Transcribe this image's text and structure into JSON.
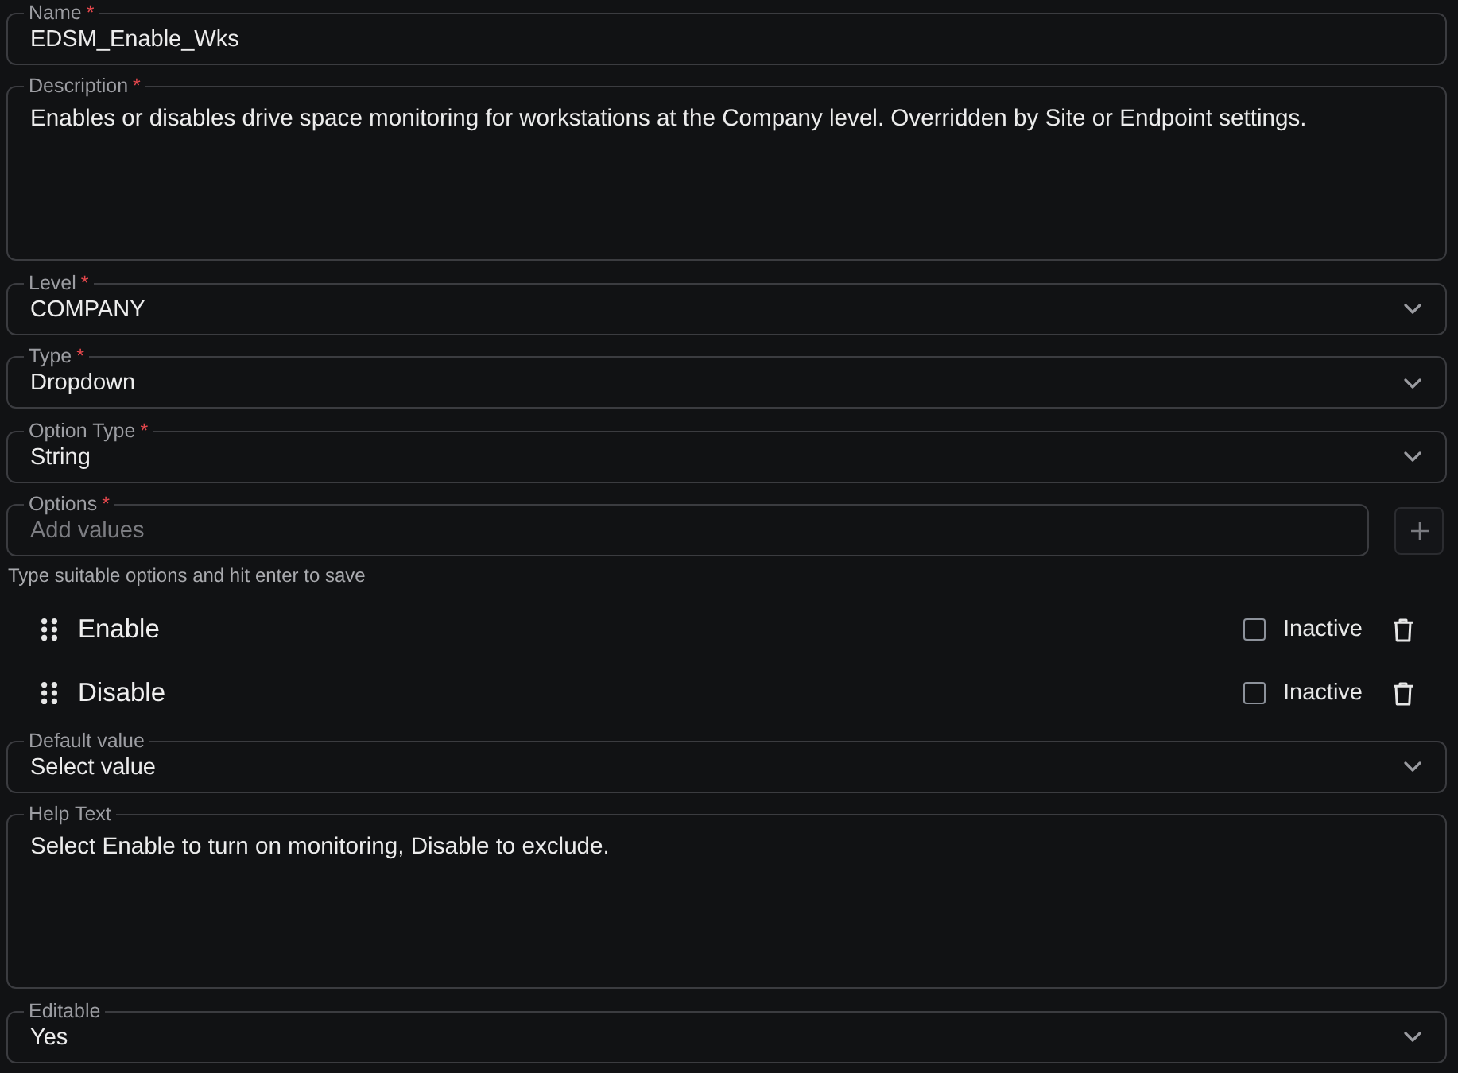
{
  "fields": [
    {
      "kind": "text",
      "label": "Name",
      "required_mark": "*",
      "value": "EDSM_Enable_Wks"
    },
    {
      "kind": "textarea",
      "label": "Description",
      "required_mark": "*",
      "value": "Enables or disables drive space monitoring for workstations at the Company level. Overridden by Site or Endpoint settings."
    },
    {
      "kind": "select",
      "label": "Level",
      "required_mark": "*",
      "value": "COMPANY"
    },
    {
      "kind": "select",
      "label": "Type",
      "required_mark": "*",
      "value": "Dropdown"
    },
    {
      "kind": "select",
      "label": "Option Type",
      "required_mark": "*",
      "value": "String"
    },
    {
      "kind": "tags",
      "label": "Options",
      "required_mark": "*",
      "placeholder": "Add values",
      "hint": "Type suitable options and hit enter to save",
      "items": [
        {
          "label": "Enable",
          "checkbox_label": "Inactive",
          "checked": false
        },
        {
          "label": "Disable",
          "checkbox_label": "Inactive",
          "checked": false
        }
      ]
    },
    {
      "kind": "select",
      "label": "Default value",
      "value": "Select value"
    },
    {
      "kind": "textarea",
      "label": "Help Text",
      "value": "Select Enable to turn on monitoring, Disable to exclude."
    },
    {
      "kind": "select",
      "label": "Editable",
      "value": "Yes"
    }
  ]
}
